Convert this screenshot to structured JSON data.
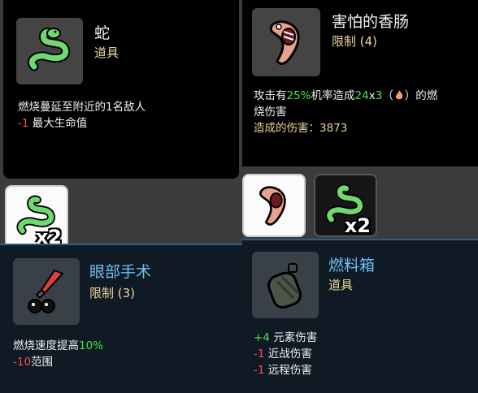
{
  "snake_tooltip": {
    "name": "蛇",
    "type": "道具",
    "desc_line1": "燃烧蔓延至附近的1名敌人",
    "stat_value": "-1",
    "stat_label": "最大生命值",
    "icon": "snake-icon"
  },
  "sausage_tooltip": {
    "name": "害怕的香肠",
    "limit": "限制 (4)",
    "desc_prefix": "攻击有",
    "chance": "25%",
    "desc_mid": "机率造成",
    "damage": "24",
    "mult_x": "x",
    "mult_n": "3",
    "paren_open": "（",
    "paren_close": "）的燃",
    "desc_line2": "烧伤害",
    "dealt_label": "造成的伤害：",
    "dealt_value": "3873",
    "icon": "scared-sausage-icon"
  },
  "inventory": {
    "snake_count": "x2",
    "snake_count_2": "x2"
  },
  "eye_surgery_tooltip": {
    "name": "眼部手术",
    "limit": "限制 (3)",
    "desc_text": "燃烧速度提高",
    "desc_value": "10%",
    "stat_value": "-10",
    "stat_label": "范围",
    "icon": "eye-surgery-icon"
  },
  "fuel_tank_tooltip": {
    "name": "燃料箱",
    "type": "道具",
    "stats": [
      {
        "value": "+4",
        "label": "元素伤害"
      },
      {
        "value": "-1",
        "label": "近战伤害"
      },
      {
        "value": "-1",
        "label": "远程伤害"
      }
    ],
    "icon": "fuel-tank-icon"
  },
  "colors": {
    "positive": "#4fe04f",
    "negative": "#ff4a4a",
    "subtitle": "#ead59a",
    "title_blue": "#6fbef1"
  }
}
